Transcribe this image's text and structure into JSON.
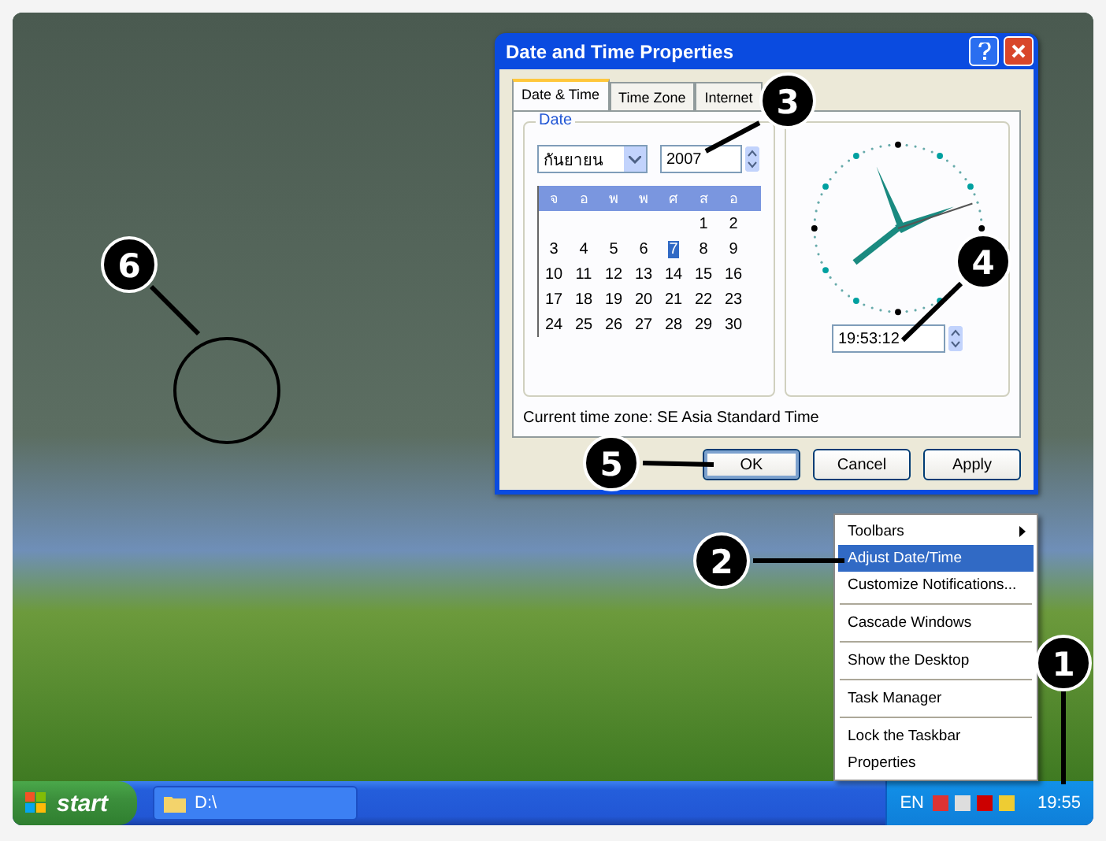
{
  "dialog": {
    "title": "Date and Time Properties",
    "tabs": [
      {
        "label": "Date & Time",
        "selected": true
      },
      {
        "label": "Time Zone",
        "selected": false
      },
      {
        "label": "Internet",
        "selected": false
      }
    ],
    "date_group": {
      "title": "Date",
      "month": "กันยายน",
      "year": "2007",
      "weekdays": [
        "จ",
        "อ",
        "พ",
        "พ",
        "ศ",
        "ส",
        "อ"
      ],
      "weeks": [
        [
          {
            "label": "1",
            "selected": false
          },
          {
            "label": "2",
            "selected": false
          }
        ],
        [
          {
            "label": "3",
            "selected": false
          },
          {
            "label": "4",
            "selected": false
          },
          {
            "label": "5",
            "selected": false
          },
          {
            "label": "6",
            "selected": false
          },
          {
            "label": "7",
            "selected": true
          },
          {
            "label": "8",
            "selected": false
          },
          {
            "label": "9",
            "selected": false
          }
        ],
        [
          {
            "label": "10",
            "selected": false
          },
          {
            "label": "11",
            "selected": false
          },
          {
            "label": "12",
            "selected": false
          },
          {
            "label": "13",
            "selected": false
          },
          {
            "label": "14",
            "selected": false
          },
          {
            "label": "15",
            "selected": false
          },
          {
            "label": "16",
            "selected": false
          }
        ],
        [
          {
            "label": "17",
            "selected": false
          },
          {
            "label": "18",
            "selected": false
          },
          {
            "label": "19",
            "selected": false
          },
          {
            "label": "20",
            "selected": false
          },
          {
            "label": "21",
            "selected": false
          },
          {
            "label": "22",
            "selected": false
          },
          {
            "label": "23",
            "selected": false
          }
        ],
        [
          {
            "label": "24",
            "selected": false
          },
          {
            "label": "25",
            "selected": false
          },
          {
            "label": "26",
            "selected": false
          },
          {
            "label": "27",
            "selected": false
          },
          {
            "label": "28",
            "selected": false
          },
          {
            "label": "29",
            "selected": false
          },
          {
            "label": "30",
            "selected": false
          }
        ]
      ]
    },
    "time": "19:53:12",
    "timezone": "Current time zone:  SE Asia Standard Time",
    "buttons": [
      {
        "label": "OK",
        "selected": true
      },
      {
        "label": "Cancel",
        "selected": false
      },
      {
        "label": "Apply",
        "selected": false
      }
    ]
  },
  "context_menu": [
    {
      "kind": "item",
      "label": "Toolbars",
      "selected": false,
      "submenu": true
    },
    {
      "kind": "item",
      "label": "Adjust Date/Time",
      "selected": true,
      "submenu": false
    },
    {
      "kind": "item",
      "label": "Customize Notifications...",
      "selected": false,
      "submenu": false
    },
    {
      "kind": "separator"
    },
    {
      "kind": "item",
      "label": "Cascade Windows",
      "selected": false,
      "submenu": false
    },
    {
      "kind": "separator"
    },
    {
      "kind": "item",
      "label": "Show the Desktop",
      "selected": false,
      "submenu": false
    },
    {
      "kind": "separator"
    },
    {
      "kind": "item",
      "label": "Task Manager",
      "selected": false,
      "submenu": false
    },
    {
      "kind": "separator"
    },
    {
      "kind": "item",
      "label": "Lock the Taskbar",
      "selected": false,
      "submenu": false
    },
    {
      "kind": "item",
      "label": "Properties",
      "selected": false,
      "submenu": false
    }
  ],
  "taskbar": {
    "start": "start",
    "task": "D:\\",
    "language": "EN",
    "clock": "19:55"
  },
  "annotations": [
    "1",
    "2",
    "3",
    "4",
    "5",
    "6"
  ]
}
